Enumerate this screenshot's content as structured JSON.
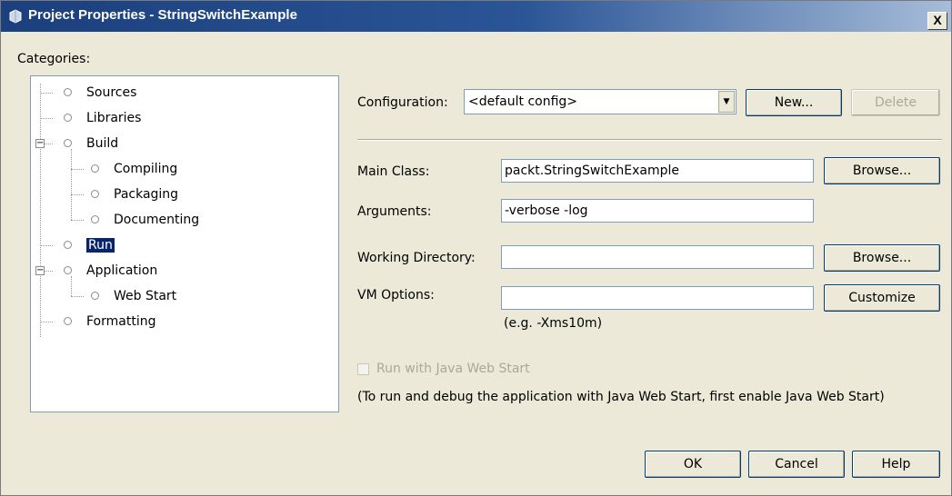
{
  "window": {
    "title": "Project Properties - StringSwitchExample",
    "close_label": "X"
  },
  "categories": {
    "label": "Categories:",
    "items": [
      {
        "label": "Sources"
      },
      {
        "label": "Libraries"
      },
      {
        "label": "Build"
      },
      {
        "label": "Compiling"
      },
      {
        "label": "Packaging"
      },
      {
        "label": "Documenting"
      },
      {
        "label": "Run",
        "selected": true
      },
      {
        "label": "Application"
      },
      {
        "label": "Web Start"
      },
      {
        "label": "Formatting"
      }
    ]
  },
  "configuration": {
    "label": "Configuration:",
    "value": "<default config>",
    "new_label": "New...",
    "delete_label": "Delete"
  },
  "form": {
    "main_class_label": "Main Class:",
    "main_class_value": "packt.StringSwitchExample",
    "arguments_label": "Arguments:",
    "arguments_value": "-verbose -log",
    "working_dir_label": "Working Directory:",
    "working_dir_value": "",
    "vm_options_label": "VM Options:",
    "vm_options_value": "",
    "vm_hint": "(e.g. -Xms10m)",
    "browse_label": "Browse...",
    "browse2_label": "Browse...",
    "customize_label": "Customize"
  },
  "webstart": {
    "checkbox_label": "Run with Java Web Start",
    "note": "(To run and debug the application with Java Web Start, first enable Java Web Start)"
  },
  "footer": {
    "ok_label": "OK",
    "cancel_label": "Cancel",
    "help_label": "Help"
  },
  "colors": {
    "title_bar": "#1c3f7d",
    "selection": "#0a246a",
    "dialog_bg": "#ece9d8"
  },
  "icons": [
    "app-icon",
    "close-icon",
    "dropdown-arrow-icon",
    "tree-node-icon",
    "collapse-icon"
  ]
}
